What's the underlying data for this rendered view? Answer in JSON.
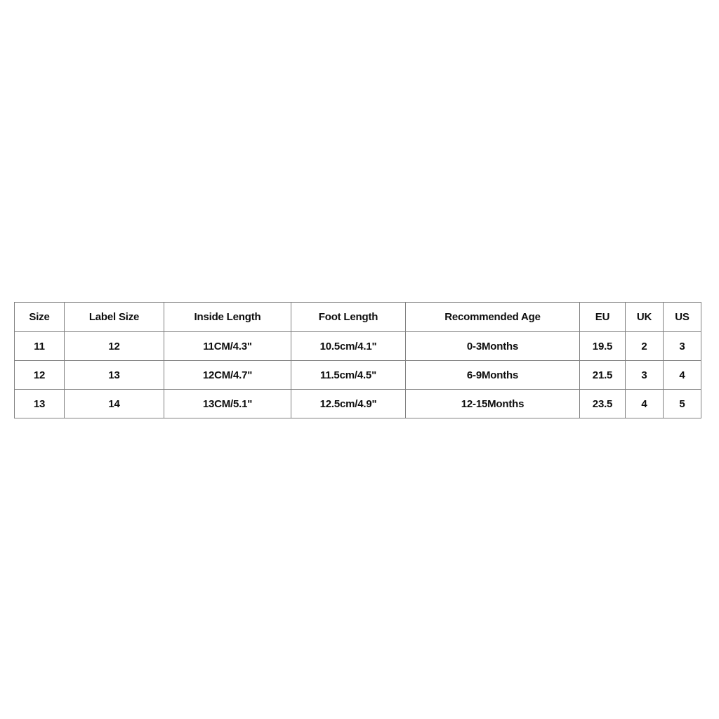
{
  "chart_data": {
    "type": "table",
    "title": "",
    "columns": [
      "Size",
      "Label Size",
      "Inside Length",
      "Foot Length",
      "Recommended Age",
      "EU",
      "UK",
      "US"
    ],
    "rows": [
      [
        "11",
        "12",
        "11CM/4.3\"",
        "10.5cm/4.1\"",
        "0-3Months",
        "19.5",
        "2",
        "3"
      ],
      [
        "12",
        "13",
        "12CM/4.7\"",
        "11.5cm/4.5\"",
        "6-9Months",
        "21.5",
        "3",
        "4"
      ],
      [
        "13",
        "14",
        "13CM/5.1\"",
        "12.5cm/4.9\"",
        "12-15Months",
        "23.5",
        "4",
        "5"
      ]
    ]
  },
  "table": {
    "headers": [
      {
        "key": "size",
        "label": "Size"
      },
      {
        "key": "label_size",
        "label": "Label Size"
      },
      {
        "key": "inside_length",
        "label": "Inside Length"
      },
      {
        "key": "foot_length",
        "label": "Foot Length"
      },
      {
        "key": "recommended_age",
        "label": "Recommended Age"
      },
      {
        "key": "eu",
        "label": "EU"
      },
      {
        "key": "uk",
        "label": "UK"
      },
      {
        "key": "us",
        "label": "US"
      }
    ],
    "rows": [
      {
        "size": "11",
        "label_size": "12",
        "inside_length": "11CM/4.3\"",
        "foot_length": "10.5cm/4.1\"",
        "recommended_age": "0-3Months",
        "eu": "19.5",
        "uk": "2",
        "us": "3"
      },
      {
        "size": "12",
        "label_size": "13",
        "inside_length": "12CM/4.7\"",
        "foot_length": "11.5cm/4.5\"",
        "recommended_age": "6-9Months",
        "eu": "21.5",
        "uk": "3",
        "us": "4"
      },
      {
        "size": "13",
        "label_size": "14",
        "inside_length": "13CM/5.1\"",
        "foot_length": "12.5cm/4.9\"",
        "recommended_age": "12-15Months",
        "eu": "23.5",
        "uk": "4",
        "us": "5"
      }
    ]
  },
  "colors": {
    "background": "#ffffff",
    "border": "#808080",
    "text": "#0d0d0d"
  }
}
